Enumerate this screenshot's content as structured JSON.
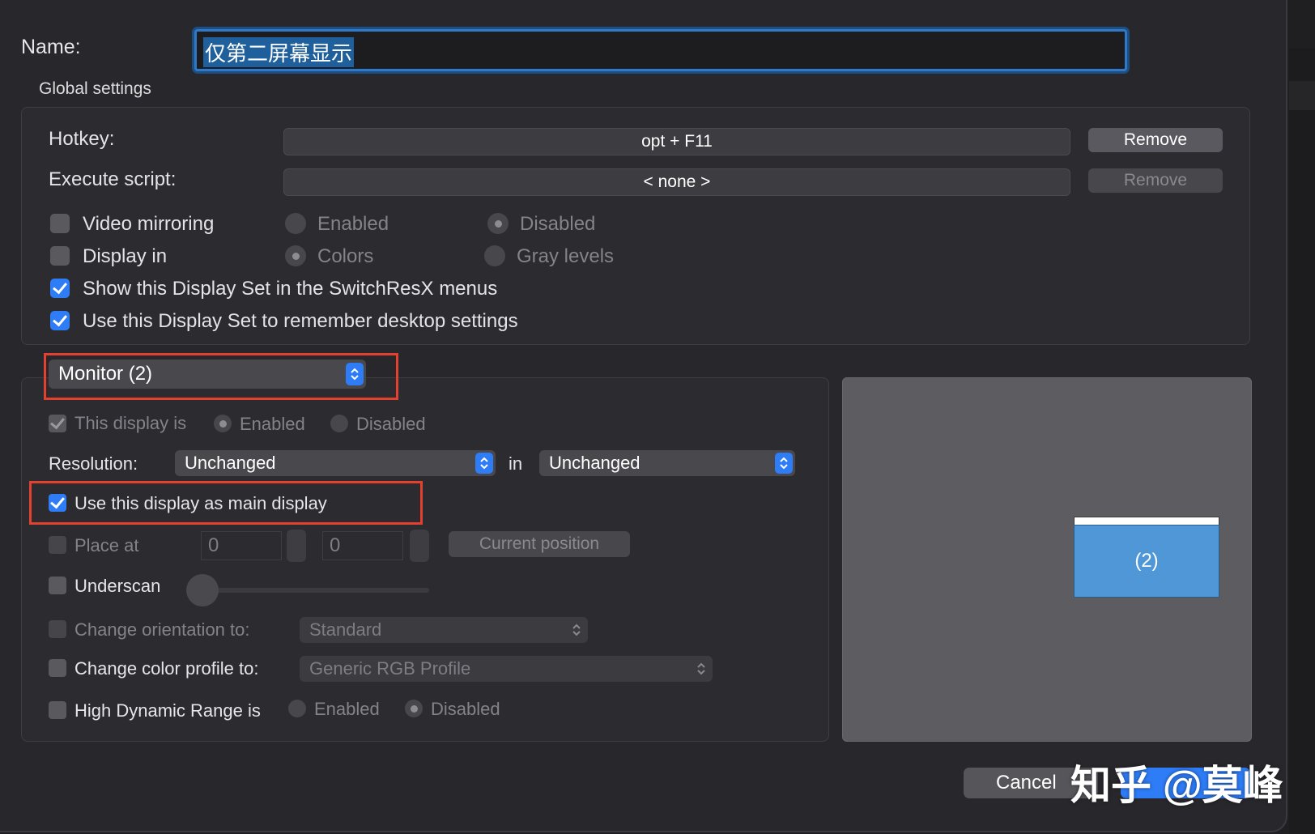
{
  "name": {
    "label": "Name:",
    "value": "仅第二屏幕显示"
  },
  "global": {
    "title": "Global settings",
    "hotkey": {
      "label": "Hotkey:",
      "value": "opt + F11",
      "remove": "Remove"
    },
    "script": {
      "label": "Execute script:",
      "value": "< none >",
      "remove": "Remove"
    },
    "video_mirroring": {
      "label": "Video mirroring",
      "opt1": "Enabled",
      "opt2": "Disabled"
    },
    "display_in": {
      "label": "Display in",
      "opt1": "Colors",
      "opt2": "Gray levels"
    },
    "show_in_menus": "Show this Display Set in the SwitchResX menus",
    "remember_desktop": "Use this Display Set to remember desktop settings"
  },
  "monitor": {
    "selector": "Monitor (2)",
    "this_display": {
      "label": "This display is",
      "opt1": "Enabled",
      "opt2": "Disabled"
    },
    "resolution": {
      "label": "Resolution:",
      "value": "Unchanged",
      "in_label": "in",
      "depth": "Unchanged"
    },
    "main_display": "Use this display as main display",
    "place_at": {
      "label": "Place at",
      "x": "0",
      "y": "0",
      "button": "Current position"
    },
    "underscan": "Underscan",
    "orientation": {
      "label": "Change orientation to:",
      "value": "Standard"
    },
    "color_profile": {
      "label": "Change color profile to:",
      "value": "Generic RGB Profile"
    },
    "hdr": {
      "label": "High Dynamic Range is",
      "opt1": "Enabled",
      "opt2": "Disabled"
    }
  },
  "preview": {
    "screen_label": "(2)"
  },
  "footer": {
    "cancel": "Cancel",
    "watermark": "知乎 @莫峰"
  },
  "colors": {
    "accent": "#2e7cf6",
    "highlight": "#e2412f",
    "screen": "#4f97d6"
  }
}
